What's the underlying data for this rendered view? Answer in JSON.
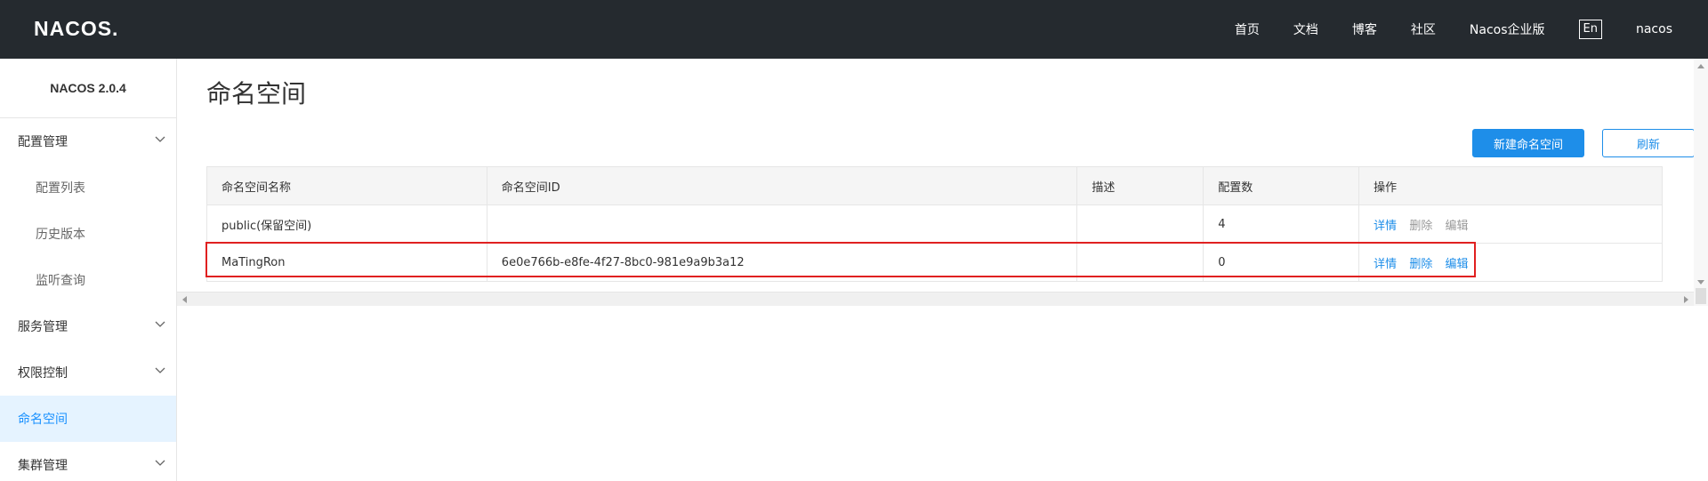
{
  "header": {
    "logo": "NACOS.",
    "nav": [
      "首页",
      "文档",
      "博客",
      "社区",
      "Nacos企业版"
    ],
    "lang": "En",
    "user": "nacos"
  },
  "sidebar": {
    "version": "NACOS 2.0.4",
    "items": [
      {
        "label": "配置管理",
        "type": "group",
        "chevron": true
      },
      {
        "label": "配置列表",
        "type": "sub"
      },
      {
        "label": "历史版本",
        "type": "sub"
      },
      {
        "label": "监听查询",
        "type": "sub"
      },
      {
        "label": "服务管理",
        "type": "group",
        "chevron": true
      },
      {
        "label": "权限控制",
        "type": "group",
        "chevron": true
      },
      {
        "label": "命名空间",
        "type": "group",
        "active": true
      },
      {
        "label": "集群管理",
        "type": "group",
        "chevron": true
      }
    ]
  },
  "main": {
    "title": "命名空间",
    "new_button": "新建命名空间",
    "refresh_button": "刷新",
    "table": {
      "headers": [
        "命名空间名称",
        "命名空间ID",
        "描述",
        "配置数",
        "操作"
      ],
      "rows": [
        {
          "name": "public(保留空间)",
          "id": "",
          "desc": "",
          "count": "4",
          "ops": [
            {
              "label": "详情",
              "enabled": true
            },
            {
              "label": "删除",
              "enabled": false
            },
            {
              "label": "编辑",
              "enabled": false
            }
          ]
        },
        {
          "name": "MaTingRon",
          "id": "6e0e766b-e8fe-4f27-8bc0-981e9a9b3a12",
          "desc": "",
          "count": "0",
          "ops": [
            {
              "label": "详情",
              "enabled": true
            },
            {
              "label": "删除",
              "enabled": true
            },
            {
              "label": "编辑",
              "enabled": true
            }
          ]
        }
      ]
    }
  },
  "colors": {
    "header_bg": "#252a2f",
    "primary": "#1e8ee9",
    "active_bg": "#e5f3ff",
    "active_text": "#1890ff",
    "highlight_border": "#e02020"
  }
}
